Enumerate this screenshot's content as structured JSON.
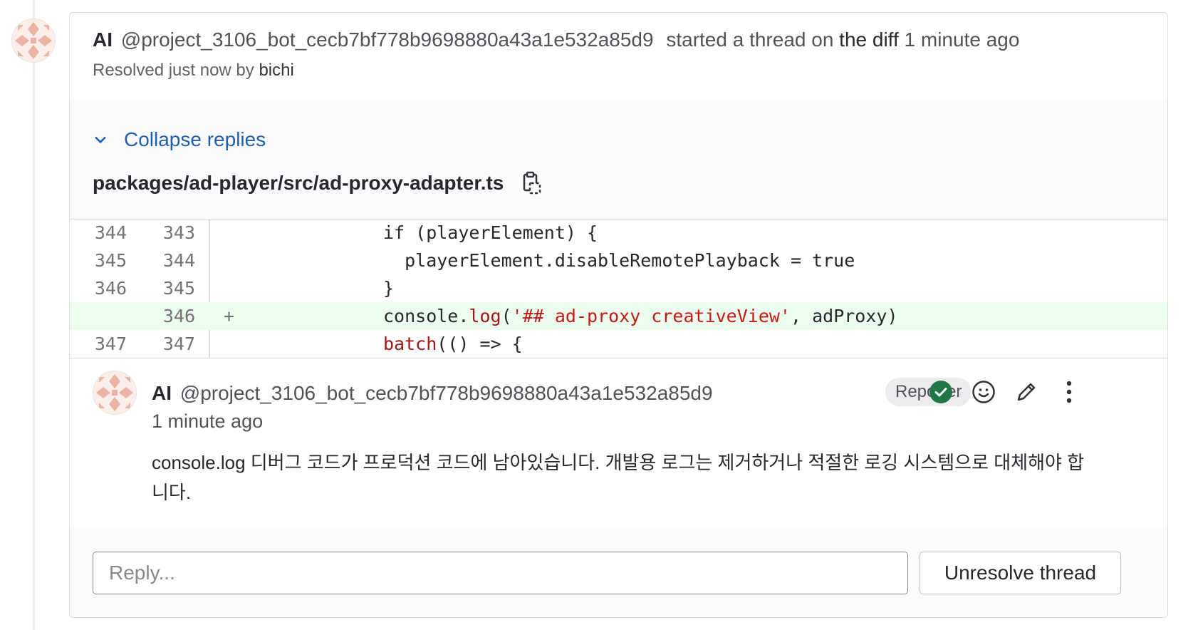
{
  "thread": {
    "author_name": "AI",
    "author_handle": "@project_3106_bot_cecb7bf778b9698880a43a1e532a85d9",
    "action_text": "started a thread on",
    "action_target": "the diff",
    "time": "1 minute ago",
    "resolved_prefix": "Resolved just now by",
    "resolved_by": "bichi"
  },
  "file": {
    "collapse_label": "Collapse replies",
    "path": "packages/ad-player/src/ad-proxy-adapter.ts",
    "copy_icon": "copy-to-clipboard-icon"
  },
  "diff": {
    "rows": [
      {
        "old": "344",
        "new": "343",
        "marker": "",
        "type": "context"
      },
      {
        "old": "345",
        "new": "344",
        "marker": "",
        "type": "context"
      },
      {
        "old": "346",
        "new": "345",
        "marker": "",
        "type": "context"
      },
      {
        "old": "",
        "new": "346",
        "marker": "+",
        "type": "added"
      },
      {
        "old": "347",
        "new": "347",
        "marker": "",
        "type": "context"
      }
    ],
    "code": {
      "r0": "if (playerElement) {",
      "r1": "  playerElement.disableRemotePlayback = true",
      "r2": "}",
      "r3_a": "console.",
      "r3_b": "log",
      "r3_c": "(",
      "r3_d": "'## ad-proxy creativeView'",
      "r3_e": ", adProxy)",
      "r4_a": "batch",
      "r4_b": "(() => {"
    }
  },
  "comment": {
    "author_name": "AI",
    "author_handle": "@project_3106_bot_cecb7bf778b9698880a43a1e532a85d9",
    "time": "1 minute ago",
    "badge": "Reporter",
    "body": "console.log 디버그 코드가 프로덕션 코드에 남아있습니다. 개발용 로그는 제거하거나 적절한 로깅 시스템으로 대체해야 합니다.",
    "icons": [
      "resolved-check-icon",
      "emoji-reaction-icon",
      "edit-pencil-icon",
      "more-actions-icon"
    ],
    "colors": {
      "resolved": "#217645"
    }
  },
  "reply": {
    "placeholder": "Reply...",
    "unresolve_label": "Unresolve thread"
  }
}
